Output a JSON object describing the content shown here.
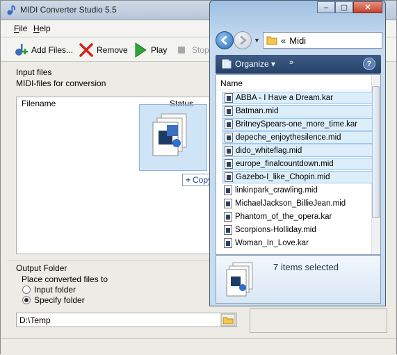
{
  "app": {
    "title": "MIDI Converter Studio 5.5",
    "menu": [
      {
        "label": "File",
        "underline": "F",
        "rest": "ile"
      },
      {
        "label": "Help",
        "underline": "H",
        "rest": "elp"
      }
    ],
    "toolbar": {
      "add_files": "Add Files...",
      "remove": "Remove",
      "play": "Play",
      "stop": "Stop"
    },
    "input_files": {
      "title": "Input files",
      "subtitle": "MIDI-files for conversion",
      "columns": {
        "filename": "Filename",
        "status": "Status"
      }
    },
    "output": {
      "title": "Output Folder",
      "subtitle": "Place converted files to",
      "options": [
        {
          "label": "Input folder",
          "selected": false
        },
        {
          "label": "Specify folder",
          "selected": true
        }
      ],
      "folder": "D:\\Temp"
    }
  },
  "drag": {
    "tooltip": "Copy"
  },
  "explorer": {
    "address": {
      "prefix": "«",
      "folder": "Midi"
    },
    "commands": {
      "organize": "Organize",
      "more": "»",
      "help": "?"
    },
    "column": "Name",
    "files": [
      {
        "name": "ABBA - I Have a Dream.kar",
        "selected": true
      },
      {
        "name": "Batman.mid",
        "selected": true
      },
      {
        "name": "BritneySpears-one_more_time.kar",
        "selected": true
      },
      {
        "name": "depeche_enjoythesilence.mid",
        "selected": true
      },
      {
        "name": "dido_whiteflag.mid",
        "selected": true
      },
      {
        "name": "europe_finalcountdown.mid",
        "selected": true
      },
      {
        "name": "Gazebo-I_like_Chopin.mid",
        "selected": true
      },
      {
        "name": "linkinpark_crawling.mid",
        "selected": false
      },
      {
        "name": "MichaelJackson_BillieJean.mid",
        "selected": false
      },
      {
        "name": "Phantom_of_the_opera.kar",
        "selected": false
      },
      {
        "name": "Scorpions-Holliday.mid",
        "selected": false
      },
      {
        "name": "Woman_In_Love.kar",
        "selected": false
      }
    ],
    "details": "7 items selected"
  }
}
